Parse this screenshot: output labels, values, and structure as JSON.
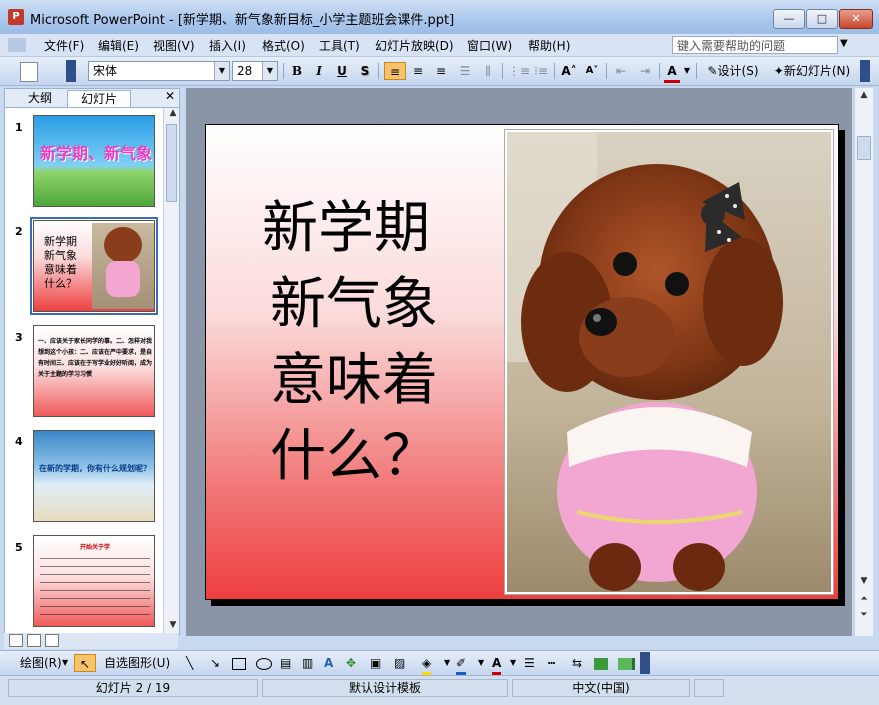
{
  "window": {
    "title": "Microsoft PowerPoint - [新学期、新气象新目标_小学主题班会课件.ppt]",
    "app_icon_letter": "P",
    "min_label": "—",
    "max_label": "□",
    "close_label": "✕"
  },
  "menubar": {
    "items": [
      "文件(F)",
      "编辑(E)",
      "视图(V)",
      "插入(I)",
      "格式(O)",
      "工具(T)",
      "幻灯片放映(D)",
      "窗口(W)",
      "帮助(H)"
    ],
    "help_placeholder": "键入需要帮助的问题"
  },
  "toolbar": {
    "font_name": "宋体",
    "font_size": "28",
    "bold": "B",
    "italic": "I",
    "underline": "U",
    "shadow": "S",
    "font_color_label": "A",
    "design_label": "设计(S)",
    "new_slide_label": "新幻灯片(N)"
  },
  "pane": {
    "tabs": [
      "大纲",
      "幻灯片"
    ],
    "close_label": "✕",
    "thumbnails": [
      {
        "number": "1",
        "text": "新学期、新气象"
      },
      {
        "number": "2",
        "text": "新学期 新气象 意味着 什么？"
      },
      {
        "number": "3",
        "text": "一、应该关于家长同学的事。二、怎样对我想到这个小孩：二、应该在严中要求，是自有时间三、应该在于写学业好好听阅，成为关于主题的学习习惯"
      },
      {
        "number": "4",
        "text": "在新的学期，你有什么规划呢？"
      },
      {
        "number": "5",
        "text": "开始关于学"
      }
    ]
  },
  "slide": {
    "title_lines": [
      "新学期",
      "新气象",
      "意味着",
      "什么？"
    ],
    "bg_colors": [
      "#ffffff",
      "#ee3f3f"
    ]
  },
  "drawbar": {
    "draw_label": "绘图(R)",
    "autoshape_label": "自选图形(U)"
  },
  "status": {
    "slide_info": "幻灯片 2 / 19",
    "template": "默认设计模板",
    "language": "中文(中国)"
  }
}
